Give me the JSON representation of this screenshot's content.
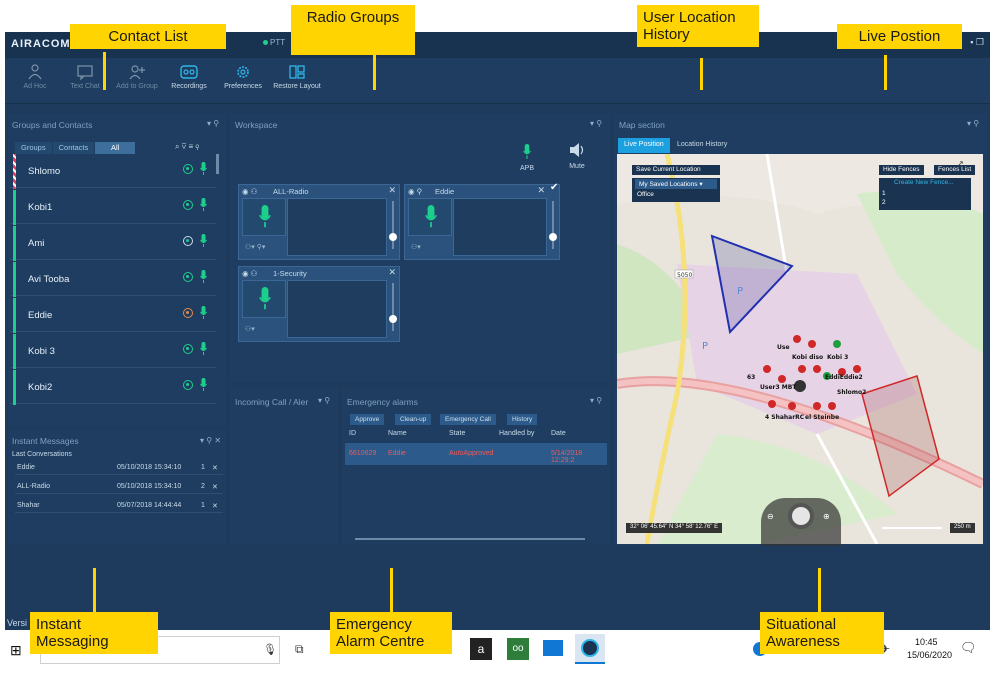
{
  "app": {
    "logo": "AIRACOM",
    "tab_ptt": "PTT",
    "version_prefix": "Versi"
  },
  "toolbar": {
    "buttons": [
      {
        "label": "Ad Hoc"
      },
      {
        "label": "Text Chat"
      },
      {
        "label": "Add to Group"
      },
      {
        "label": "Recordings"
      },
      {
        "label": "Preferences"
      },
      {
        "label": "Restore Layout"
      }
    ]
  },
  "groups_panel": {
    "title": "Groups and Contacts",
    "tabs": [
      "Groups",
      "Contacts",
      "All"
    ],
    "contacts": [
      {
        "name": "Shlomo"
      },
      {
        "name": "Kobi1"
      },
      {
        "name": "Ami"
      },
      {
        "name": "Avi Tooba"
      },
      {
        "name": "Eddie"
      },
      {
        "name": "Kobi 3"
      },
      {
        "name": "Kobi2"
      }
    ]
  },
  "messages_panel": {
    "title": "Instant Messages",
    "subtitle": "Last Conversations",
    "rows": [
      {
        "name": "Eddie",
        "time": "05/10/2018 15:34:10",
        "count": "1"
      },
      {
        "name": "ALL-Radio",
        "time": "05/10/2018 15:34:10",
        "count": "2"
      },
      {
        "name": "Shahar",
        "time": "05/07/2018 14:44:44",
        "count": "1"
      }
    ]
  },
  "workspace": {
    "title": "Workspace",
    "apb": "APB",
    "mute": "Mute",
    "cards": [
      {
        "name": "ALL-Radio"
      },
      {
        "name": "Eddie"
      },
      {
        "name": "1-Security"
      }
    ]
  },
  "incoming": {
    "title": "Incoming Call / Aler"
  },
  "emergency": {
    "title": "Emergency alarms",
    "buttons": [
      "Approve",
      "Clean-up",
      "Emergency Call",
      "History"
    ],
    "columns": [
      "ID",
      "Name",
      "State",
      "Handled by",
      "Date"
    ],
    "rows": [
      {
        "id": "6610629",
        "name": "Eddie",
        "state": "AutoApproved",
        "handled_by": "",
        "date": "5/14/2018 12:29:2"
      }
    ]
  },
  "map": {
    "title": "Map section",
    "tabs": [
      "Live Position",
      "Location History"
    ],
    "save_location": "Save Current Location",
    "saved_locations": "My Saved Locations",
    "saved_item": "Office",
    "hide_fences": "Hide Fences",
    "fences_list": "Fences List",
    "create_fence": "Create New Fence...",
    "fence_items": [
      "1",
      "2"
    ],
    "coords": "32° 06' 45.64\" N 34° 58' 12.76\" E",
    "scale": "250 m",
    "road_label": "5050",
    "map_labels": [
      "Use",
      "Kobi diso",
      "Kobi 3",
      "63",
      "User3 MBT",
      "EddiEddie2",
      "Shlomo2",
      "4 ShaharRC",
      "el Steinbe"
    ]
  },
  "callouts": {
    "contact_list": "Contact List",
    "radio_groups": "Radio Groups",
    "user_location_history": "User Location History",
    "live_position": "Live Postion",
    "instant_messaging": "Instant Messaging",
    "emergency_alarm_centre": "Emergency Alarm Centre",
    "situational_awareness": "Situational Awareness"
  },
  "taskbar": {
    "time": "10:45",
    "date": "15/06/2020"
  }
}
